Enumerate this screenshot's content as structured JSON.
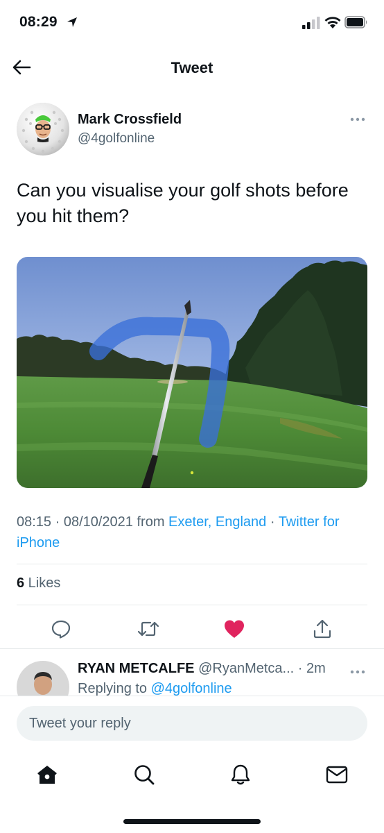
{
  "status_bar": {
    "time": "08:29",
    "icons": [
      "location-arrow-icon",
      "cellular-signal-icon",
      "wifi-icon",
      "battery-icon"
    ]
  },
  "nav": {
    "title": "Tweet",
    "back_icon": "back-arrow-icon"
  },
  "tweet": {
    "author_name": "Mark Crossfield",
    "author_handle": "@4golfonline",
    "text": "Can you visualise your golf shots before you hit them?",
    "meta_time": "08:15 · 08/10/2021 from ",
    "meta_location": "Exeter, England",
    "meta_sep": " · ",
    "meta_source": "Twitter for iPhone",
    "likes_count": "6",
    "likes_label": " Likes",
    "liked": true
  },
  "actions": [
    "reply-icon",
    "retweet-icon",
    "like-heart-icon",
    "share-icon"
  ],
  "reply": {
    "name": "RYAN METCALFE",
    "handle": "@RyanMetca...",
    "time": "· 2m",
    "replying_to_label": "Replying to ",
    "replying_to_handle": "@4golfonline"
  },
  "reply_box": {
    "placeholder": "Tweet your reply"
  },
  "tab_bar": [
    "home-icon",
    "search-icon",
    "notifications-bell-icon",
    "messages-mail-icon"
  ],
  "colors": {
    "accent": "#1d9bf0",
    "like": "#e0245e",
    "text": "#0f1419",
    "secondary": "#536471"
  }
}
